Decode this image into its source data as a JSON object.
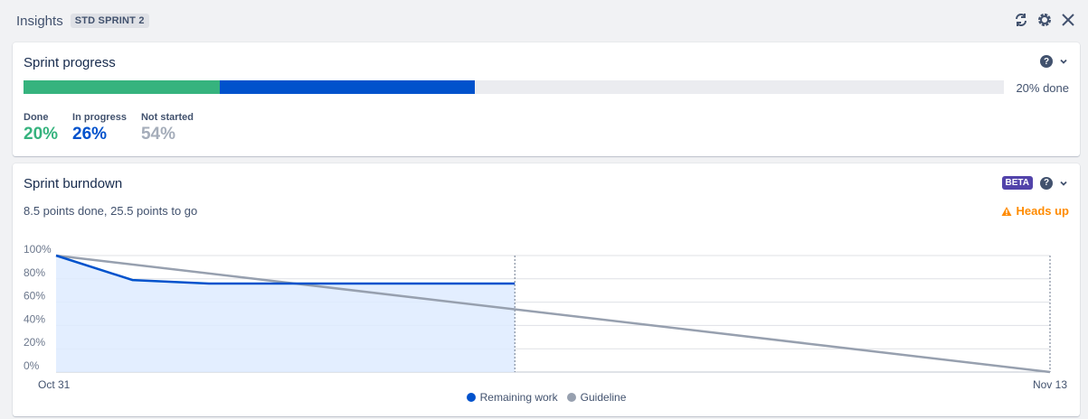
{
  "header": {
    "title": "Insights",
    "sprint_badge": "STD SPRINT 2"
  },
  "icons": {
    "refresh": "refresh-icon",
    "settings": "gear-icon",
    "close": "close-icon",
    "help": "question-circle-icon",
    "chevron": "chevron-down-icon",
    "warning": "warning-icon"
  },
  "sprint_progress": {
    "title": "Sprint progress",
    "done_pct_label": "20% done",
    "done_fraction": 0.2,
    "in_progress_fraction": 0.26,
    "stats": [
      {
        "label": "Done",
        "value": "20%",
        "color": "#36b37e"
      },
      {
        "label": "In progress",
        "value": "26%",
        "color": "#0052cc"
      },
      {
        "label": "Not started",
        "value": "54%",
        "color": "#a5adba"
      }
    ]
  },
  "burndown": {
    "title": "Sprint burndown",
    "beta_badge": "BETA",
    "summary": "8.5 points done, 25.5 points to go",
    "warning_label": "Heads up"
  },
  "chart_data": {
    "type": "line",
    "ylim": [
      0,
      100
    ],
    "y_ticks": [
      "100%",
      "80%",
      "60%",
      "40%",
      "20%",
      "0%"
    ],
    "x_start_label": "Oct 31",
    "x_end_label": "Nov 13",
    "x_range_days": [
      0,
      13
    ],
    "today_day": 6,
    "grid": true,
    "legend_position": "bottom",
    "series": [
      {
        "name": "Remaining work",
        "color": "#0052cc",
        "points": [
          [
            0,
            100
          ],
          [
            1,
            79
          ],
          [
            2,
            76
          ],
          [
            6,
            76
          ]
        ]
      },
      {
        "name": "Guideline",
        "color": "#97a0af",
        "points": [
          [
            0,
            100
          ],
          [
            13,
            0
          ]
        ]
      }
    ]
  }
}
